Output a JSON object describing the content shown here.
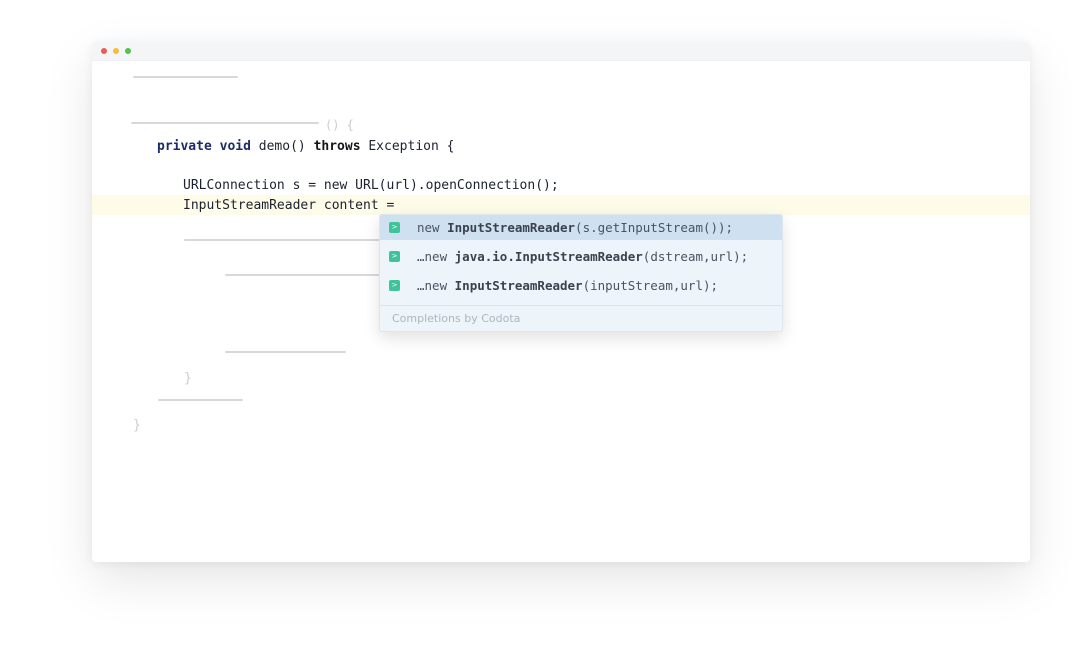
{
  "window": {
    "controls": [
      "close-dot",
      "minimize-dot",
      "zoom-dot"
    ]
  },
  "code": {
    "faded_paren": "() {",
    "method_keyword_private": "private",
    "method_keyword_void": "void",
    "method_name": "demo()",
    "method_keyword_throws": "throws",
    "method_exception": "Exception {",
    "line_connection": "URLConnection s = new URL(url).openConnection();",
    "line_reader": "InputStreamReader content =",
    "closing_inner": "}",
    "closing_outer": "}"
  },
  "completions": {
    "items": [
      {
        "prefix": "new ",
        "bold": "InputStreamReader",
        "rest": "(s.getInputStream());"
      },
      {
        "prefix": "…new ",
        "bold": "java.io.InputStreamReader",
        "rest": "(dstream,url);"
      },
      {
        "prefix": "…new ",
        "bold": "InputStreamReader",
        "rest": "(inputStream,url);"
      }
    ],
    "footer": "Completions by Codota",
    "icon": "codota-icon",
    "accent": "#3ec39b"
  }
}
